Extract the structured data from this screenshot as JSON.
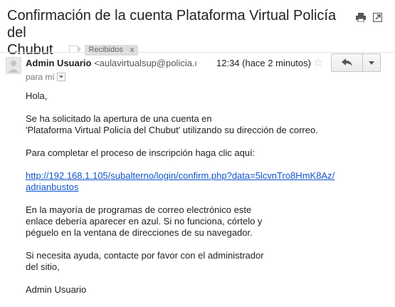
{
  "subject": {
    "line1": "Confirmación de la cuenta Plataforma Virtual Policía del",
    "line2": "Chubut",
    "label": "Recibidos",
    "label_close": "x"
  },
  "header": {
    "sender_name": "Admin Usuario",
    "sender_email": "<aulavirtualsup@policia.c",
    "time": "12:34 (hace 2 minutos)",
    "recipient": "para mí",
    "reply_icon": "reply-icon",
    "more_icon": "chevron-down-icon"
  },
  "body": {
    "greeting": "Hola,",
    "para1_line1": "Se ha solicitado la apertura de una cuenta en",
    "para1_line2": "'Plataforma Virtual Policía del Chubut' utilizando su dirección de correo.",
    "para2": "Para completar el proceso de inscripción haga clic aquí:",
    "link_line1": "http://192.168.1.105/subalterno/login/confirm.php?data=5lcvnTro8HmK8Az/",
    "link_line2": "adrianbustos",
    "para3_line1": "En la mayoría de programas de correo electrónico este",
    "para3_line2": "enlace debería aparecer en azul. Si no funciona, córtelo y",
    "para3_line3": "péguelo en la ventana de direcciones de su navegador.",
    "para4_line1": "Si necesita ayuda, contacte por favor con el administrador",
    "para4_line2": "del sitio,",
    "signature": "Admin Usuario"
  },
  "colors": {
    "link": "#1155cc",
    "label_bg": "#dddddd"
  }
}
